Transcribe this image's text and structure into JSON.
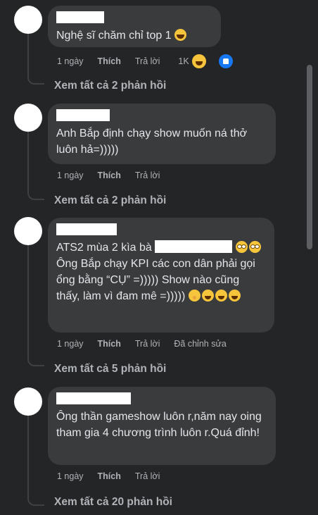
{
  "comments": [
    {
      "text": "Nghệ sĩ chăm chỉ top 1",
      "time": "1 ngày",
      "like": "Thích",
      "reply": "Trả lời",
      "reactions": "1K",
      "view_replies": "Xem tất cả 2 phản hồi"
    },
    {
      "text": "Anh Bắp định chạy show muốn ná thở luôn hả=)))))",
      "time": "1 ngày",
      "like": "Thích",
      "reply": "Trả lời",
      "view_replies": "Xem tất cả 2 phản hồi"
    },
    {
      "text_a": "ATS2 mùa 2 kìa bà",
      "text_b": "Ông Bắp chạy KPI các con dân phải gọi ổng bằng “CỤ” =))))) Show nào cũng thấy, làm vì đam mê =)))))",
      "time": "1 ngày",
      "like": "Thích",
      "reply": "Trả lời",
      "edited": "Đã chỉnh sửa",
      "view_replies": "Xem tất cả 5 phản hồi"
    },
    {
      "text": "Ông thần gameshow luôn r,năm nay oing tham gia 4 chương trình luôn r.Quá đỉnh!",
      "time": "1 ngày",
      "like": "Thích",
      "reply": "Trả lời",
      "view_replies": "Xem tất cả 20 phản hồi"
    }
  ],
  "colors": {
    "background": "#242526",
    "bubble": "#3a3b3c",
    "text": "#e4e6eb",
    "muted": "#b0b3b8",
    "like_blue": "#1877f2"
  }
}
